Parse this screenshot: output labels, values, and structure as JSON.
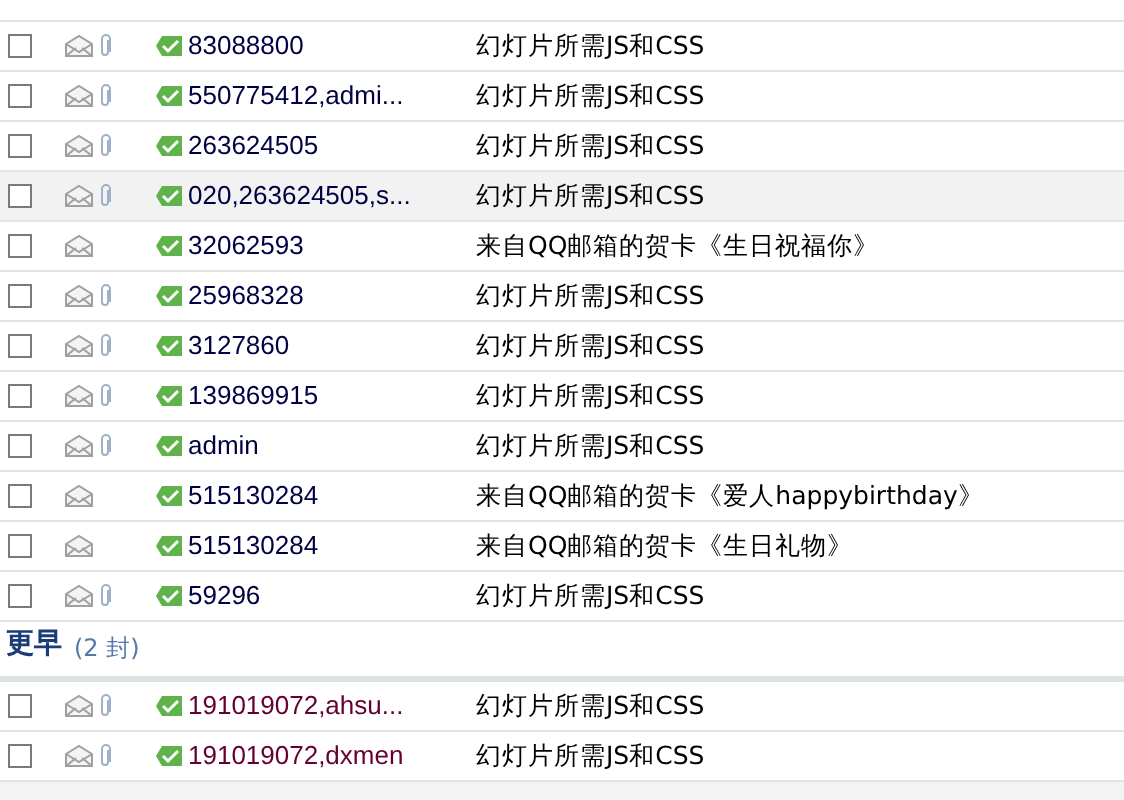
{
  "groups": [
    {
      "rows": [
        {
          "checked": false,
          "attachment": true,
          "sender": "83088800",
          "subject": "幻灯片所需JS和CSS",
          "selected": false
        },
        {
          "checked": false,
          "attachment": true,
          "sender": "550775412,admi...",
          "subject": "幻灯片所需JS和CSS",
          "selected": false
        },
        {
          "checked": false,
          "attachment": true,
          "sender": "263624505",
          "subject": "幻灯片所需JS和CSS",
          "selected": false
        },
        {
          "checked": false,
          "attachment": true,
          "sender": "020,263624505,s...",
          "subject": "幻灯片所需JS和CSS",
          "selected": true
        },
        {
          "checked": false,
          "attachment": false,
          "sender": "32062593",
          "subject": "来自QQ邮箱的贺卡《生日祝福你》",
          "selected": false
        },
        {
          "checked": false,
          "attachment": true,
          "sender": "25968328",
          "subject": "幻灯片所需JS和CSS",
          "selected": false
        },
        {
          "checked": false,
          "attachment": true,
          "sender": "3127860",
          "subject": "幻灯片所需JS和CSS",
          "selected": false
        },
        {
          "checked": false,
          "attachment": true,
          "sender": "139869915",
          "subject": "幻灯片所需JS和CSS",
          "selected": false
        },
        {
          "checked": false,
          "attachment": true,
          "sender": "admin",
          "subject": "幻灯片所需JS和CSS",
          "selected": false
        },
        {
          "checked": false,
          "attachment": false,
          "sender": "515130284",
          "subject": "来自QQ邮箱的贺卡《爱人happybirthday》",
          "selected": false
        },
        {
          "checked": false,
          "attachment": false,
          "sender": "515130284",
          "subject": "来自QQ邮箱的贺卡《生日礼物》",
          "selected": false
        },
        {
          "checked": false,
          "attachment": true,
          "sender": "59296",
          "subject": "幻灯片所需JS和CSS",
          "selected": false
        }
      ]
    },
    {
      "title": "更早",
      "count": "(2 封)",
      "rows": [
        {
          "checked": false,
          "attachment": true,
          "sender": "191019072,ahsu...",
          "subject": "幻灯片所需JS和CSS",
          "selected": false,
          "color": "#660033"
        },
        {
          "checked": false,
          "attachment": true,
          "sender": "191019072,dxmen",
          "subject": "幻灯片所需JS和CSS",
          "selected": false,
          "color": "#660033"
        }
      ]
    }
  ]
}
